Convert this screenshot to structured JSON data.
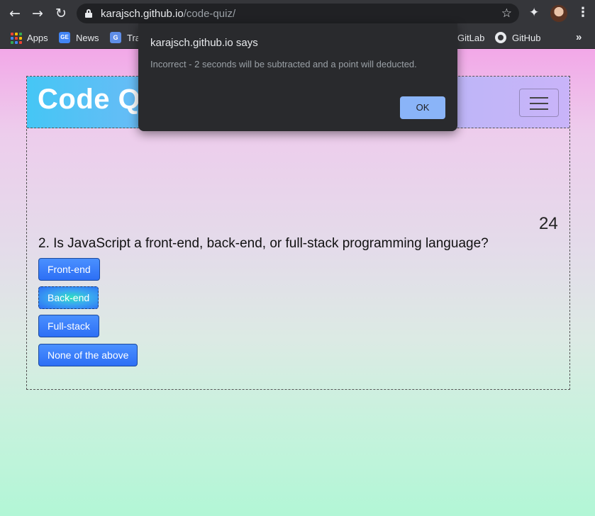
{
  "browser": {
    "url_host": "karajsch.github.io",
    "url_path": "/code-quiz/",
    "nav_icons": {
      "back": "arrow-left-icon",
      "forward": "arrow-right-icon",
      "reload": "reload-icon"
    },
    "bookmarks": [
      {
        "label": "Apps",
        "icon": "apps-grid-icon"
      },
      {
        "label": "News",
        "icon": "google-news-icon"
      },
      {
        "label": "Tra",
        "icon": "translate-icon"
      },
      {
        "label": "GitLab",
        "icon": "gitlab-icon"
      },
      {
        "label": "GitHub",
        "icon": "github-icon"
      }
    ]
  },
  "header": {
    "title": "Code Quiz",
    "gradient_start": "#45c6f5",
    "gradient_end": "#c9b4f9"
  },
  "quiz": {
    "timer": "24",
    "question": "2. Is JavaScript a front-end, back-end, or full-stack programming language?",
    "answers": [
      "Front-end",
      "Back-end",
      "Full-stack",
      "None of the above"
    ]
  },
  "dialog": {
    "title": "karajsch.github.io says",
    "message": "Incorrect - 2 seconds will be subtracted and a point will deducted.",
    "ok_label": "OK"
  },
  "colors": {
    "button_blue": "#2d6ff5",
    "dialog_bg": "#292a2d",
    "ok_button": "#8ab4f8"
  }
}
